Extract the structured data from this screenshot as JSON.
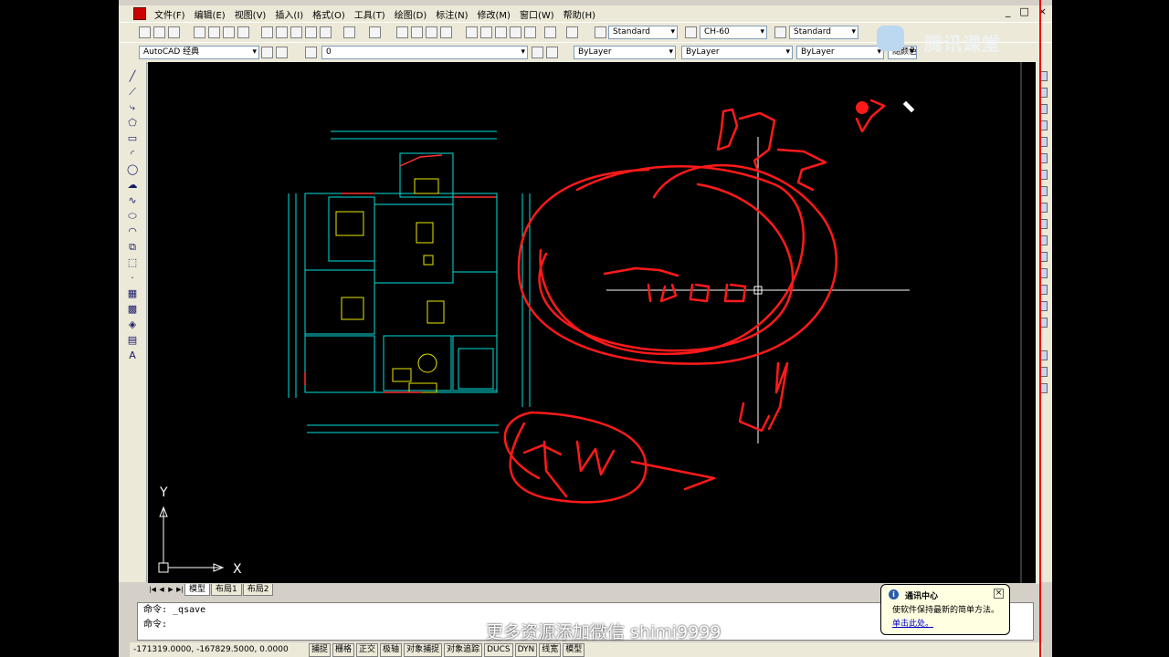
{
  "menu": [
    "文件(F)",
    "编辑(E)",
    "视图(V)",
    "插入(I)",
    "格式(O)",
    "工具(T)",
    "绘图(D)",
    "标注(N)",
    "修改(M)",
    "窗口(W)",
    "帮助(H)"
  ],
  "toolbar": {
    "text_style": "Standard",
    "dim_style": "CH-60",
    "table_style": "Standard",
    "workspace": "AutoCAD 经典",
    "layer": "0",
    "color": "ByLayer",
    "linetype": "ByLayer",
    "lineweight": "ByLayer",
    "plotstyle": "随颜色"
  },
  "layout_tabs": [
    "模型",
    "布局1",
    "布局2"
  ],
  "command": {
    "history": "命令: _qsave",
    "prompt": "命令:"
  },
  "status": {
    "coords": "-171319.0000, -167829.5000, 0.0000",
    "buttons": [
      "捕捉",
      "栅格",
      "正交",
      "极轴",
      "对象捕捉",
      "对象追踪",
      "DUCS",
      "DYN",
      "线宽",
      "模型"
    ]
  },
  "notification": {
    "title": "通讯中心",
    "body": "使软件保持最新的简单方法。",
    "link": "单击此处。"
  },
  "ucs": {
    "x_label": "X",
    "y_label": "Y"
  },
  "watermark": "更多资源添加微信 shimi9999",
  "brand": "腾讯课堂",
  "window_controls": [
    "_",
    "□",
    "×"
  ],
  "colors": {
    "annotation": "#ff1a1a",
    "drawing_cyan": "#00e0e0",
    "drawing_yellow": "#e8e800"
  }
}
